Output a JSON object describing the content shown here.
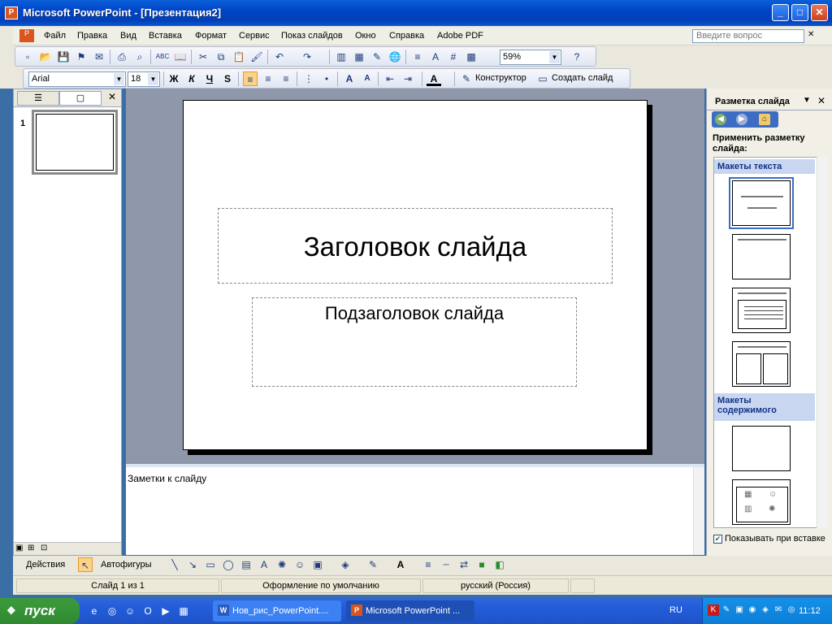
{
  "window": {
    "title": "Microsoft PowerPoint - [Презентация2]",
    "app_icon": "powerpoint-icon"
  },
  "menu": {
    "items": [
      "Файл",
      "Правка",
      "Вид",
      "Вставка",
      "Формат",
      "Сервис",
      "Показ слайдов",
      "Окно",
      "Справка",
      "Adobe PDF"
    ],
    "help_placeholder": "Введите вопрос"
  },
  "toolbar": {
    "zoom": "59%",
    "font": "Arial",
    "font_size": "18",
    "bold": "Ж",
    "italic": "К",
    "underline": "Ч",
    "shadow": "S",
    "designer": "Конструктор",
    "new_slide": "Создать слайд"
  },
  "outline": {
    "slide_number": "1"
  },
  "slide": {
    "title_placeholder": "Заголовок слайда",
    "subtitle_placeholder": "Подзаголовок слайда"
  },
  "notes": {
    "placeholder": "Заметки к слайду"
  },
  "taskpane": {
    "title": "Разметка слайда",
    "apply_label": "Применить разметку слайда:",
    "group_text": "Макеты текста",
    "group_content": "Макеты содержимого",
    "show_on_insert": "Показывать при вставке"
  },
  "drawbar": {
    "actions": "Действия",
    "autoshapes": "Автофигуры"
  },
  "status": {
    "slide": "Слайд 1 из 1",
    "design": "Оформление по умолчанию",
    "language": "русский (Россия)"
  },
  "taskbar": {
    "start": "пуск",
    "tasks": [
      "Нов_рис_PowerPoint....",
      "Microsoft PowerPoint ..."
    ],
    "lang": "RU",
    "time": "11:12"
  }
}
